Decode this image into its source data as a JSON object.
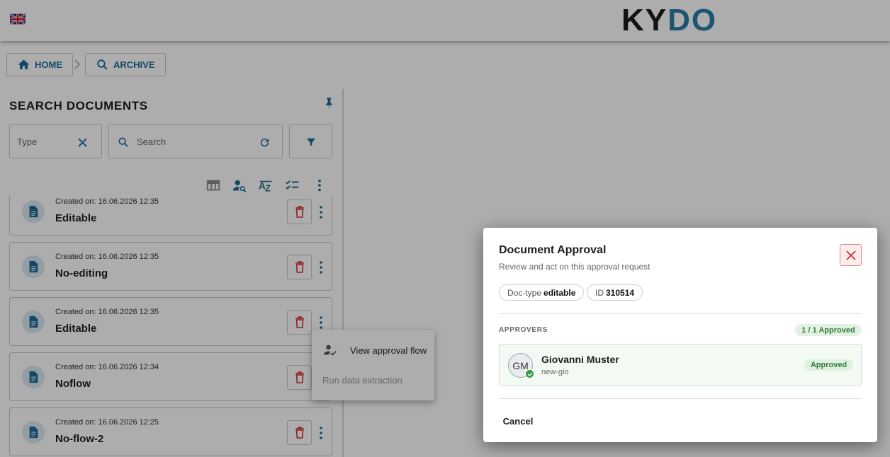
{
  "header": {
    "language_flag": "uk-flag-icon",
    "logo_text": {
      "k": "K",
      "y": "Y",
      "d": "D",
      "o": "O"
    }
  },
  "breadcrumb": {
    "home_label": "HOME",
    "archive_label": "ARCHIVE"
  },
  "search_panel": {
    "title": "SEARCH DOCUMENTS",
    "type_placeholder": "Type",
    "search_placeholder": "Search",
    "toolbar_icons": [
      "table-columns-icon",
      "person-search-icon",
      "sort-az-icon",
      "checklist-icon",
      "more-vert-icon"
    ]
  },
  "documents": [
    {
      "date": "Created on: 16.06.2026 12:35",
      "name": "Editable"
    },
    {
      "date": "Created on: 16.06.2026 12:35",
      "name": "No-editing"
    },
    {
      "date": "Created on: 16.06.2026 12:35",
      "name": "Editable"
    },
    {
      "date": "Created on: 16.06.2026 12:34",
      "name": "Noflow"
    },
    {
      "date": "Created on: 16.06.2026 12:25",
      "name": "No-flow-2"
    }
  ],
  "context_menu": {
    "view_approval_flow": "View approval flow",
    "run_data_extraction": "Run data extraction"
  },
  "modal": {
    "title": "Document Approval",
    "subtitle": "Review and act on this approval request",
    "doctype_label": "Doc-type",
    "doctype_value": "editable",
    "id_label": "ID",
    "id_value": "310514",
    "approvers_label": "APPROVERS",
    "approved_count": "1 / 1 Approved",
    "approver": {
      "initials": "GM",
      "name": "Giovanni Muster",
      "username": "new-gio",
      "status": "Approved"
    },
    "cancel_label": "Cancel"
  },
  "colors": {
    "accent": "#1f6b98",
    "danger": "#d32f2f",
    "success": "#2e7d32"
  }
}
